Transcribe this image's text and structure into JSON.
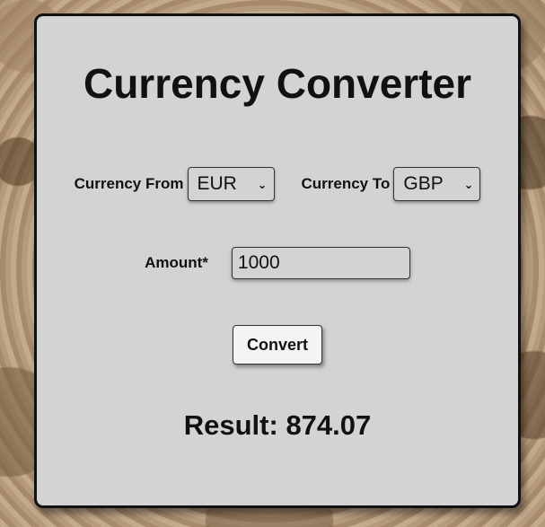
{
  "title": "Currency Converter",
  "from": {
    "label": "Currency From",
    "selected": "EUR"
  },
  "to": {
    "label": "Currency To",
    "selected": "GBP"
  },
  "amount": {
    "label": "Amount*",
    "value": "1000"
  },
  "convert_label": "Convert",
  "result": {
    "label": "Result:",
    "value": "874.07"
  },
  "colors": {
    "card_background": "#d3d3d3",
    "border": "#111111",
    "button_background": "#f4f4f4"
  }
}
